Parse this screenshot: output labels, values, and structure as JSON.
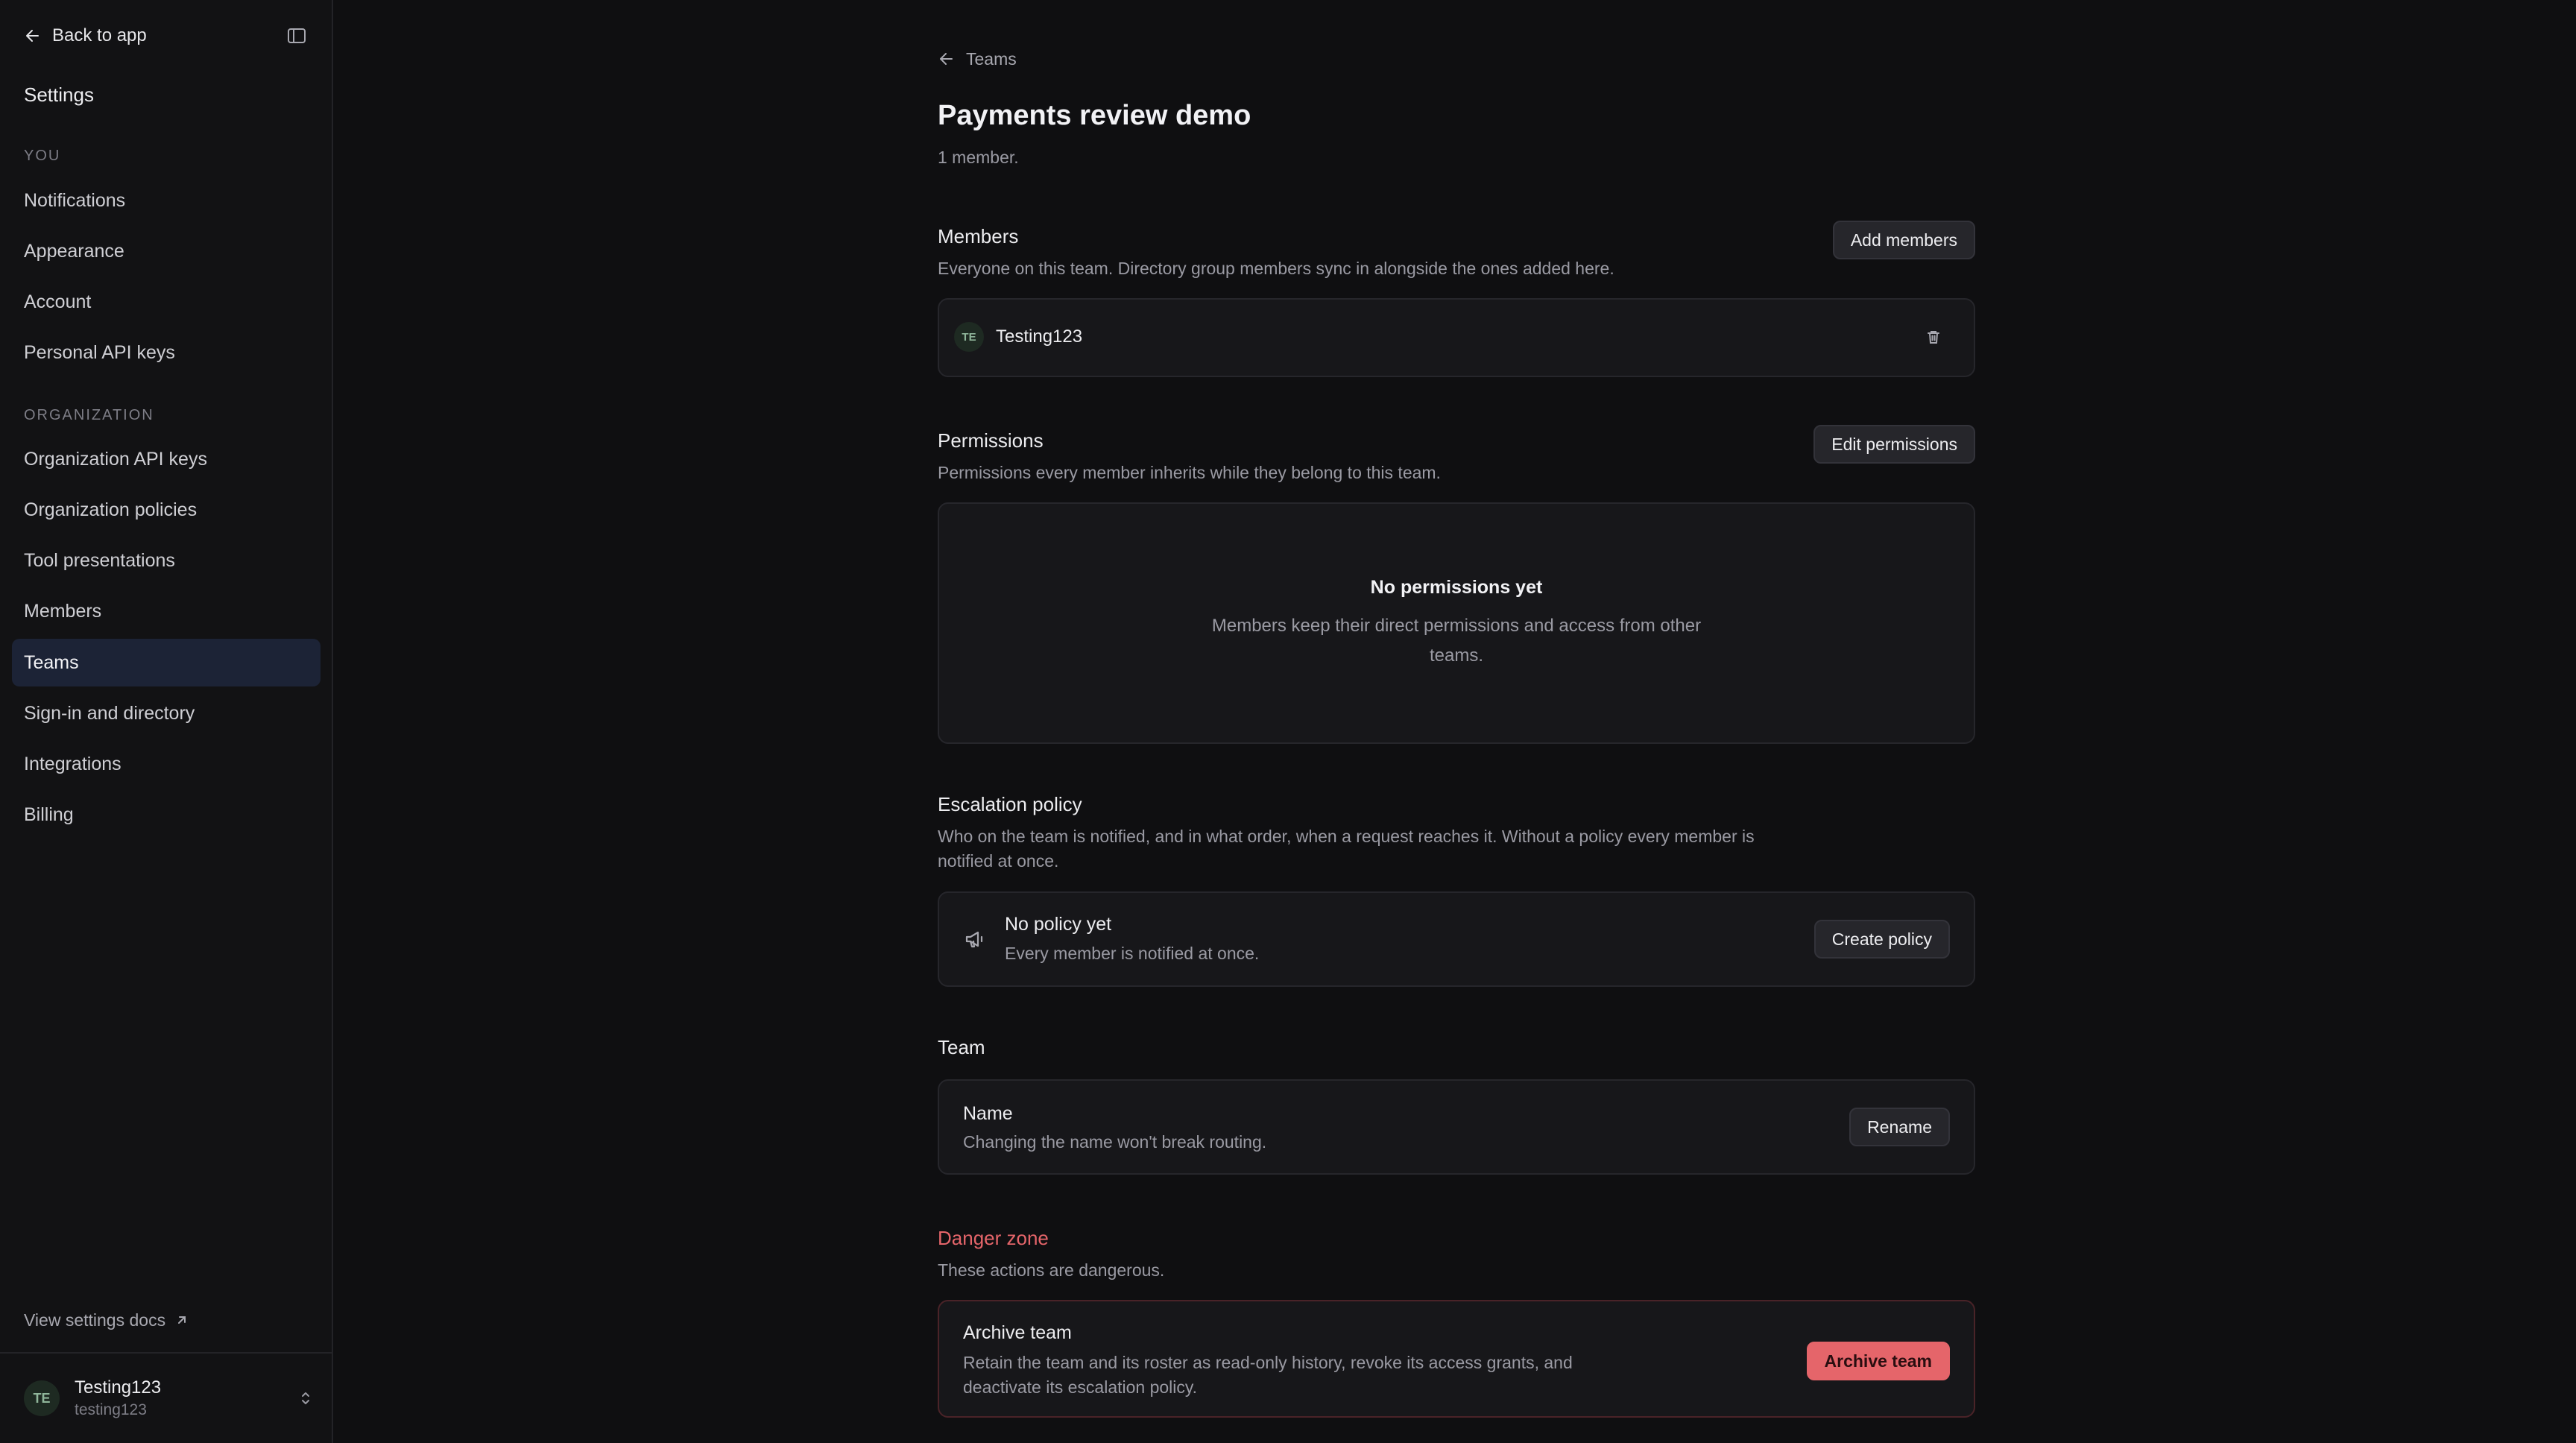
{
  "sidebar": {
    "back_label": "Back to app",
    "title": "Settings",
    "section_you": "YOU",
    "you_items": [
      "Notifications",
      "Appearance",
      "Account",
      "Personal API keys"
    ],
    "section_org": "ORGANIZATION",
    "org_items": [
      "Organization API keys",
      "Organization policies",
      "Tool presentations",
      "Members",
      "Teams",
      "Sign-in and directory",
      "Integrations",
      "Billing"
    ],
    "active_item": "Teams",
    "docs_label": "View settings docs",
    "user": {
      "initials": "TE",
      "name": "Testing123",
      "handle": "testing123"
    }
  },
  "main": {
    "breadcrumb": "Teams",
    "title": "Payments review demo",
    "subtitle": "1 member.",
    "members": {
      "title": "Members",
      "desc": "Everyone on this team. Directory group members sync in alongside the ones added here.",
      "button": "Add members",
      "list": [
        {
          "initials": "TE",
          "name": "Testing123"
        }
      ]
    },
    "permissions": {
      "title": "Permissions",
      "desc": "Permissions every member inherits while they belong to this team.",
      "button": "Edit permissions",
      "empty_title": "No permissions yet",
      "empty_desc": "Members keep their direct permissions and access from other teams."
    },
    "escalation": {
      "title": "Escalation policy",
      "desc": "Who on the team is notified, and in what order, when a request reaches it. Without a policy every member is notified at once.",
      "card_title": "No policy yet",
      "card_desc": "Every member is notified at once.",
      "button": "Create policy"
    },
    "team": {
      "title": "Team",
      "name_label": "Name",
      "name_desc": "Changing the name won't break routing.",
      "button": "Rename"
    },
    "danger": {
      "title": "Danger zone",
      "desc": "These actions are dangerous.",
      "card_title": "Archive team",
      "card_desc": "Retain the team and its roster as read-only history, revoke its access grants, and deactivate its escalation policy.",
      "button": "Archive team"
    }
  },
  "colors": {
    "accent_active": "#1c2336",
    "danger": "#e5656a",
    "avatar_bg": "#1e2a22"
  }
}
